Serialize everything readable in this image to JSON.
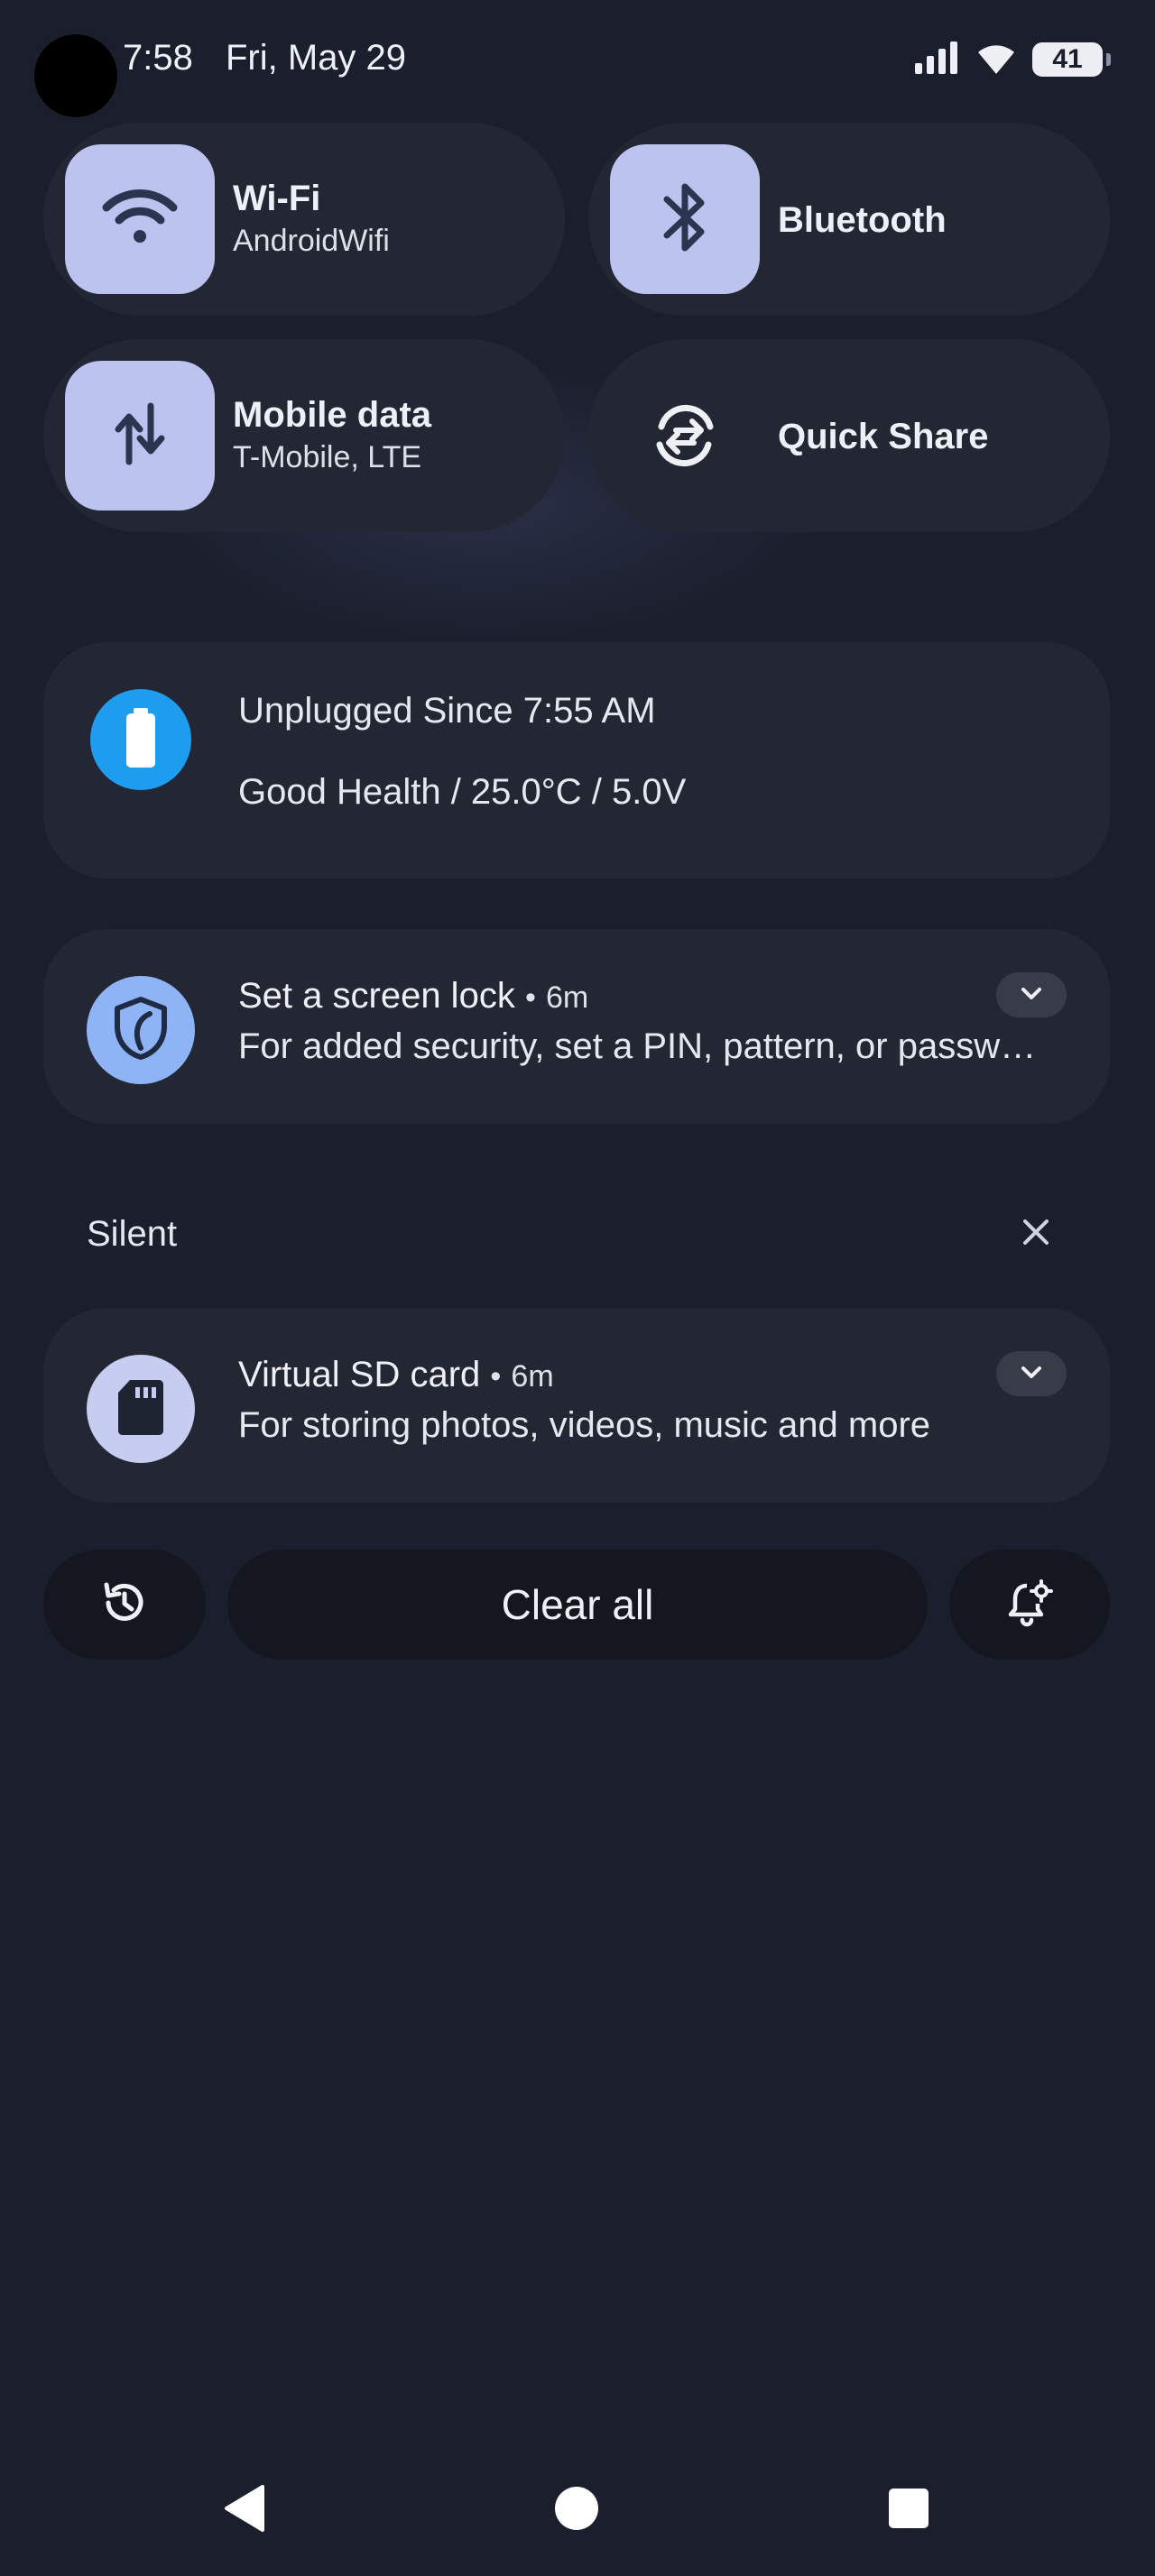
{
  "status_bar": {
    "time": "7:58",
    "date": "Fri, May 29",
    "battery_level": "41",
    "icons": [
      "camera-cutout",
      "cell-signal-icon",
      "wifi-icon",
      "battery-icon"
    ]
  },
  "quick_settings": {
    "tiles": [
      {
        "title": "Wi-Fi",
        "subtitle": "AndroidWifi",
        "icon": "wifi-icon",
        "active": true
      },
      {
        "title": "Bluetooth",
        "icon": "bluetooth-icon",
        "active": true
      },
      {
        "title": "Mobile data",
        "subtitle": "T-Mobile, LTE",
        "icon": "mobile-data-icon",
        "active": true
      },
      {
        "title": "Quick Share",
        "icon": "quick-share-icon",
        "active": false
      }
    ]
  },
  "battery_card": {
    "line1": "Unplugged Since 7:55 AM",
    "line2": "Good Health / 25.0°C / 5.0V",
    "icon": "battery-icon"
  },
  "notifications": [
    {
      "title": "Set a screen lock",
      "separator": "•",
      "age": "6m",
      "body": "For added security, set a PIN, pattern, or passw…",
      "icon": "shield-icon"
    }
  ],
  "silent_section": {
    "label": "Silent",
    "notifications": [
      {
        "title": "Virtual SD card",
        "separator": "•",
        "age": "6m",
        "body": "For storing photos, videos, music and more",
        "icon": "sd-card-icon"
      }
    ]
  },
  "footer": {
    "clear_all": "Clear all",
    "history_icon": "history-icon",
    "settings_icon": "notification-settings-icon"
  },
  "navigation": [
    "back-icon",
    "home-icon",
    "recents-icon"
  ],
  "colors": {
    "background": "#1b1f2d",
    "tile_background": "#232733",
    "tile_active": "#bcc3ee",
    "battery_accent": "#1e9cf0",
    "shield_accent": "#8fb4f5",
    "sd_accent": "#c7cdf0"
  }
}
